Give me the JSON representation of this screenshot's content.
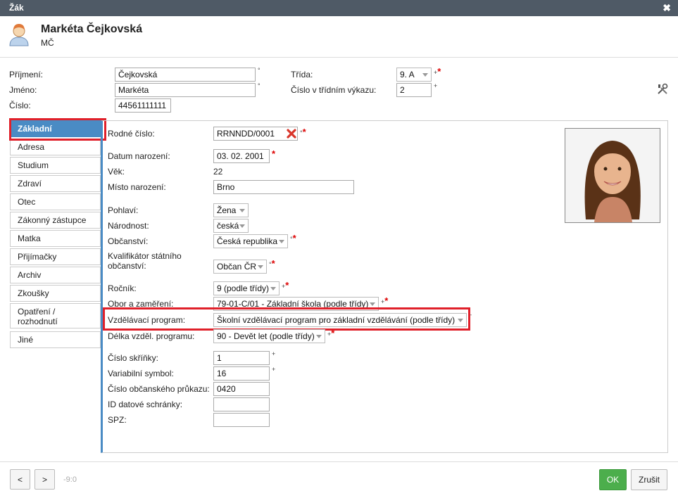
{
  "window": {
    "title": "Žák",
    "close": "✖"
  },
  "header": {
    "name": "Markéta Čejkovská",
    "initials": "MČ"
  },
  "top": {
    "prijmeni_label": "Příjmení:",
    "prijmeni_value": "Čejkovská",
    "jmeno_label": "Jméno:",
    "jmeno_value": "Markéta",
    "cislo_label": "Číslo:",
    "cislo_value": "44561111111",
    "trida_label": "Třída:",
    "trida_value": "9. A",
    "cislo_vykaz_label": "Číslo v třídním výkazu:",
    "cislo_vykaz_value": "2",
    "mark_circle": "°",
    "mark_plus": "+",
    "mark_star": "*"
  },
  "tabs": [
    {
      "label": "Základní"
    },
    {
      "label": "Adresa"
    },
    {
      "label": "Studium"
    },
    {
      "label": "Zdraví"
    },
    {
      "label": "Otec"
    },
    {
      "label": "Zákonný zástupce"
    },
    {
      "label": "Matka"
    },
    {
      "label": "Přijímačky"
    },
    {
      "label": "Archiv"
    },
    {
      "label": "Zkoušky"
    },
    {
      "label": "Opatření / rozhodnutí"
    },
    {
      "label": "Jiné"
    }
  ],
  "form": {
    "rodne_cislo_label": "Rodné číslo:",
    "rodne_cislo_value": "RRNNDD/0001",
    "datum_label": "Datum narození:",
    "datum_value": "03. 02. 2001",
    "vek_label": "Věk:",
    "vek_value": "22",
    "misto_label": "Místo narození:",
    "misto_value": "Brno",
    "pohlavi_label": "Pohlaví:",
    "pohlavi_value": "Žena",
    "narodnost_label": "Národnost:",
    "narodnost_value": "česká",
    "obcanstvi_label": "Občanství:",
    "obcanstvi_value": "Česká republika",
    "kvalifikator_label": "Kvalifikátor státního občanství:",
    "kvalifikator_value": "Občan ČR",
    "rocnik_label": "Ročník:",
    "rocnik_value": "9 (podle třídy)",
    "obor_label": "Obor a zaměření:",
    "obor_value": "79-01-C/01 - Základní škola (podle třídy)",
    "program_label": "Vzdělávací program:",
    "program_value": "Školní vzdělávací program pro základní vzdělávání (podle třídy)",
    "delka_label": "Délka vzděl. programu:",
    "delka_value": "90 - Devět let (podle třídy)",
    "skrinka_label": "Číslo skříňky:",
    "skrinka_value": "1",
    "varsym_label": "Variabilní symbol:",
    "varsym_value": "16",
    "op_label": "Číslo občanského průkazu:",
    "op_value": "0420",
    "datschr_label": "ID datové schránky:",
    "datschr_value": "",
    "spz_label": "SPZ:",
    "spz_value": ""
  },
  "footer": {
    "prev": "<",
    "next": ">",
    "position": "-9:0",
    "ok": "OK",
    "cancel": "Zrušit"
  },
  "colors": {
    "accent": "#4a8bc4",
    "required": "#dd0000",
    "highlight": "#e0202a",
    "ok": "#4cae4c"
  }
}
